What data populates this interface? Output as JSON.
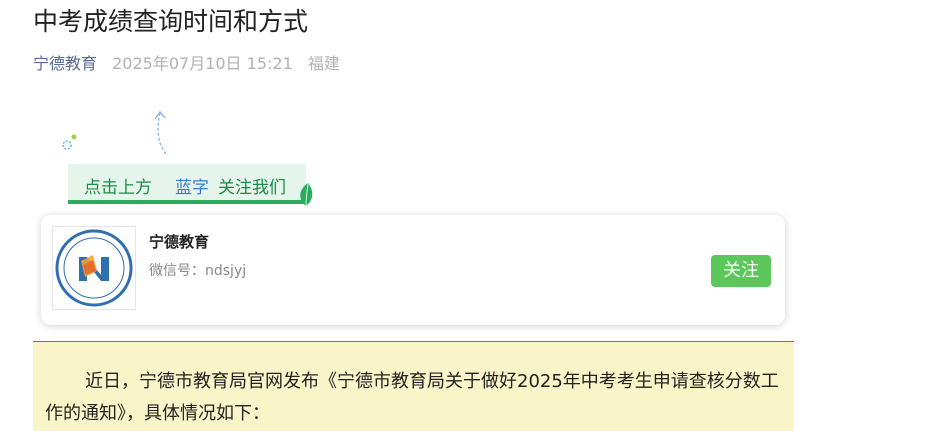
{
  "article": {
    "title": "中考成绩查询时间和方式",
    "author": "宁德教育",
    "date": "2025年07月10日 15:21",
    "location": "福建"
  },
  "follow_banner": {
    "part1": "点击上方",
    "part2": "蓝字",
    "part3": "关注我们"
  },
  "account_card": {
    "name": "宁德教育",
    "wechat_id": "微信号：ndsjyj",
    "follow_label": "关注"
  },
  "body": {
    "paragraph1": "近日，宁德市教育局官网发布《宁德市教育局关于做好2025年中考考生申请查核分数工作的通知》，具体情况如下："
  },
  "colors": {
    "accent_green": "#5cc85c",
    "author_link": "#576b95",
    "highlight_bg": "#faf5c8"
  }
}
